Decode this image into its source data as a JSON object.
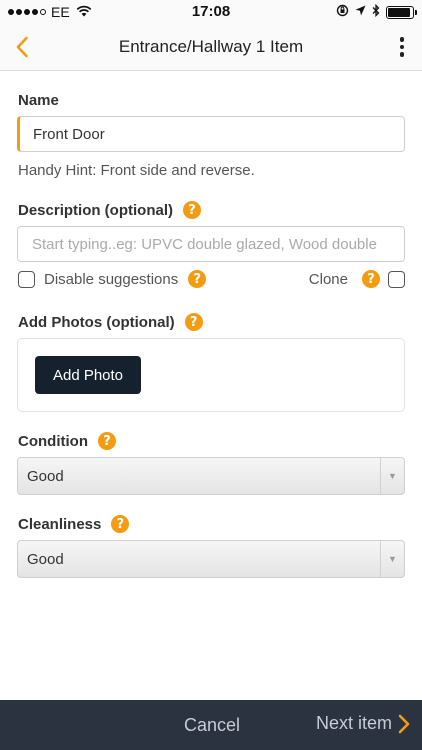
{
  "status_bar": {
    "carrier": "EE",
    "time": "17:08"
  },
  "nav": {
    "title": "Entrance/Hallway 1 Item"
  },
  "form": {
    "name_label": "Name",
    "name_value": "Front Door",
    "hint": "Handy Hint: Front side and reverse.",
    "description_label": "Description (optional)",
    "description_placeholder": "Start typing..eg: UPVC double glazed, Wood double",
    "disable_suggestions_label": "Disable suggestions",
    "clone_label": "Clone",
    "photos_label": "Add Photos (optional)",
    "add_photo_button": "Add Photo",
    "condition_label": "Condition",
    "condition_value": "Good",
    "cleanliness_label": "Cleanliness",
    "cleanliness_value": "Good",
    "help_glyph": "?"
  },
  "bottom_bar": {
    "cancel_label": "Cancel",
    "next_label": "Next item"
  },
  "colors": {
    "accent": "#f39c12",
    "bottom_bar": "#2b3240",
    "button_dark": "#16212e"
  }
}
